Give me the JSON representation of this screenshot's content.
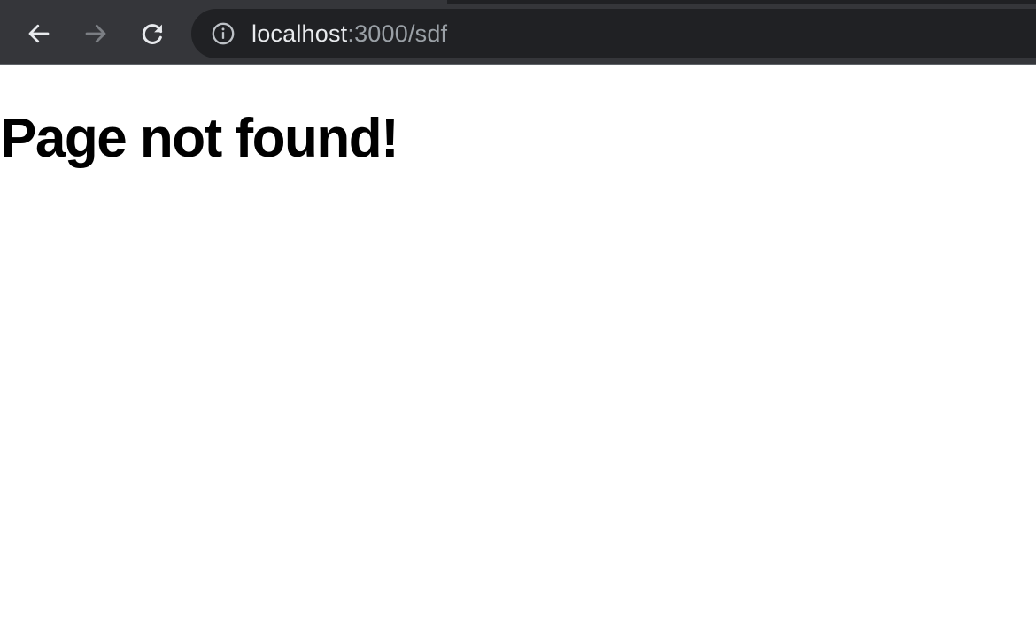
{
  "browser": {
    "url_host": "localhost",
    "url_rest": ":3000/sdf",
    "icons": {
      "back": "arrow-left-icon",
      "forward": "arrow-right-icon",
      "reload": "reload-icon",
      "site_info": "info-icon"
    },
    "forward_enabled": false
  },
  "page": {
    "heading": "Page not found!"
  },
  "colors": {
    "toolbar_bg": "#35363a",
    "omnibox_bg": "#202124",
    "url_host": "#e8eaed",
    "url_rest": "#9aa0a6",
    "icon_active": "#e8eaed",
    "icon_disabled": "#7b7e83",
    "page_bg": "#ffffff",
    "heading": "#000000"
  }
}
